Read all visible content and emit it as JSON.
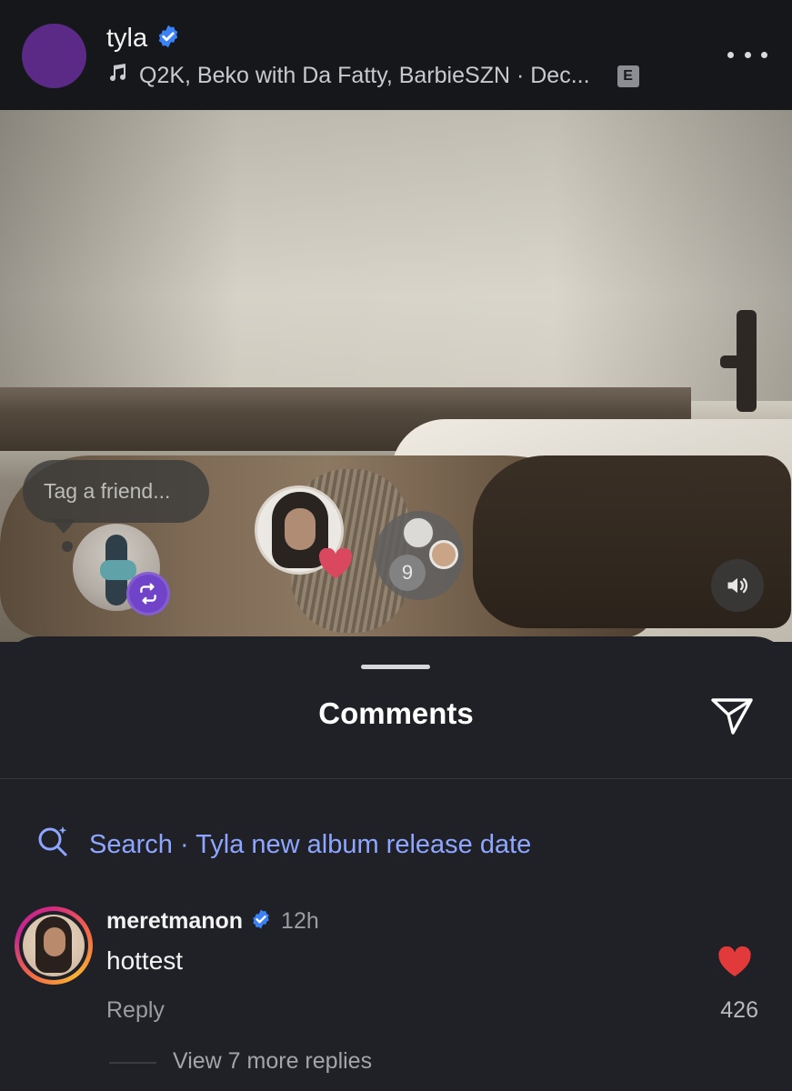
{
  "header": {
    "username": "tyla",
    "verified": true,
    "music": "Q2K, Beko with Da Fatty, BarbieSZN · Dec...",
    "explicit_badge": "E",
    "more_icon": "more-horizontal-icon"
  },
  "media": {
    "tag_prompt": "Tag a friend...",
    "facepile_count": "9",
    "repost_icon": "repost-icon",
    "like_icon": "heart-icon",
    "sound_icon": "speaker-icon"
  },
  "comments": {
    "title": "Comments",
    "share_icon": "send-icon",
    "search_label": "Search · Tyla new album release date",
    "items": [
      {
        "username": "meretmanon",
        "verified": true,
        "time": "12h",
        "text": "hottest",
        "likes": "426",
        "liked": true,
        "reply_label": "Reply",
        "more_replies": "View 7 more replies"
      }
    ]
  },
  "colors": {
    "accent_link": "#8ea6ff",
    "verified_blue": "#3b82f6",
    "like_red": "#e23a3a",
    "repost_purple": "#7043c9",
    "sheet_bg": "#1f2127",
    "header_bg": "#16171b"
  }
}
